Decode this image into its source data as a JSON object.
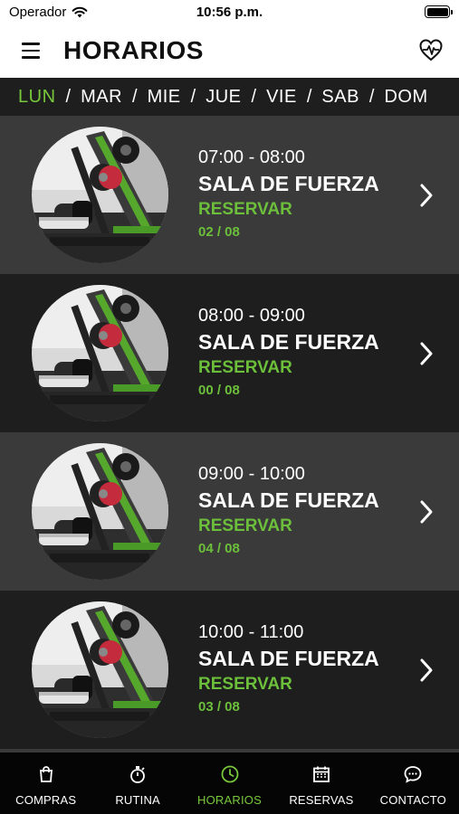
{
  "status": {
    "carrier": "Operador",
    "time": "10:56 p.m."
  },
  "header": {
    "title": "HORARIOS"
  },
  "days": [
    {
      "label": "LUN",
      "active": true
    },
    {
      "label": "MAR",
      "active": false
    },
    {
      "label": "MIE",
      "active": false
    },
    {
      "label": "JUE",
      "active": false
    },
    {
      "label": "VIE",
      "active": false
    },
    {
      "label": "SAB",
      "active": false
    },
    {
      "label": "DOM",
      "active": false
    }
  ],
  "slots": [
    {
      "hours": "07:00 - 08:00",
      "room": "SALA DE FUERZA",
      "action": "RESERVAR",
      "count": "02 / 08"
    },
    {
      "hours": "08:00 - 09:00",
      "room": "SALA DE FUERZA",
      "action": "RESERVAR",
      "count": "00 / 08"
    },
    {
      "hours": "09:00 - 10:00",
      "room": "SALA DE FUERZA",
      "action": "RESERVAR",
      "count": "04 / 08"
    },
    {
      "hours": "10:00 - 11:00",
      "room": "SALA DE FUERZA",
      "action": "RESERVAR",
      "count": "03 / 08"
    }
  ],
  "tabs": [
    {
      "label": "COMPRAS",
      "icon": "shopping-bag-icon",
      "active": false
    },
    {
      "label": "RUTINA",
      "icon": "stopwatch-icon",
      "active": false
    },
    {
      "label": "HORARIOS",
      "icon": "clock-icon",
      "active": true
    },
    {
      "label": "RESERVAS",
      "icon": "calendar-icon",
      "active": false
    },
    {
      "label": "CONTACTO",
      "icon": "chat-bubble-icon",
      "active": false
    }
  ],
  "colors": {
    "accent": "#78c83c",
    "row_light": "#3a3a3a",
    "row_dark": "#1e1e1e",
    "tabbar": "#050505"
  }
}
